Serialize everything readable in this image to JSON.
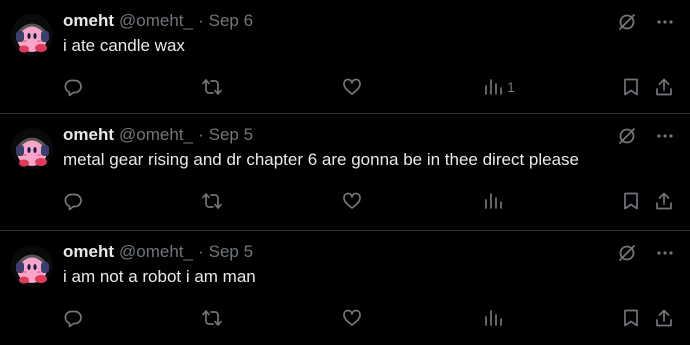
{
  "colors": {
    "background": "#000000",
    "text_primary": "#e7e9ea",
    "text_secondary": "#71767b",
    "divider": "#2f3336",
    "avatar_pink": "#f6a6c8"
  },
  "tweets": [
    {
      "display_name": "omeht",
      "handle": "@omeht_",
      "separator": "·",
      "time": "Sep 6",
      "text": "i ate candle wax",
      "views_count": "1",
      "icons": {
        "grok": "grok-icon",
        "more": "more-icon",
        "reply": "reply-icon",
        "repost": "repost-icon",
        "like": "heart-icon",
        "views": "views-icon",
        "bookmark": "bookmark-icon",
        "share": "share-icon"
      }
    },
    {
      "display_name": "omeht",
      "handle": "@omeht_",
      "separator": "·",
      "time": "Sep 5",
      "text": "metal gear rising and dr chapter 6 are gonna be in thee direct please",
      "views_count": ""
    },
    {
      "display_name": "omeht",
      "handle": "@omeht_",
      "separator": "·",
      "time": "Sep 5",
      "text": "i am not a robot i am man",
      "views_count": ""
    }
  ]
}
